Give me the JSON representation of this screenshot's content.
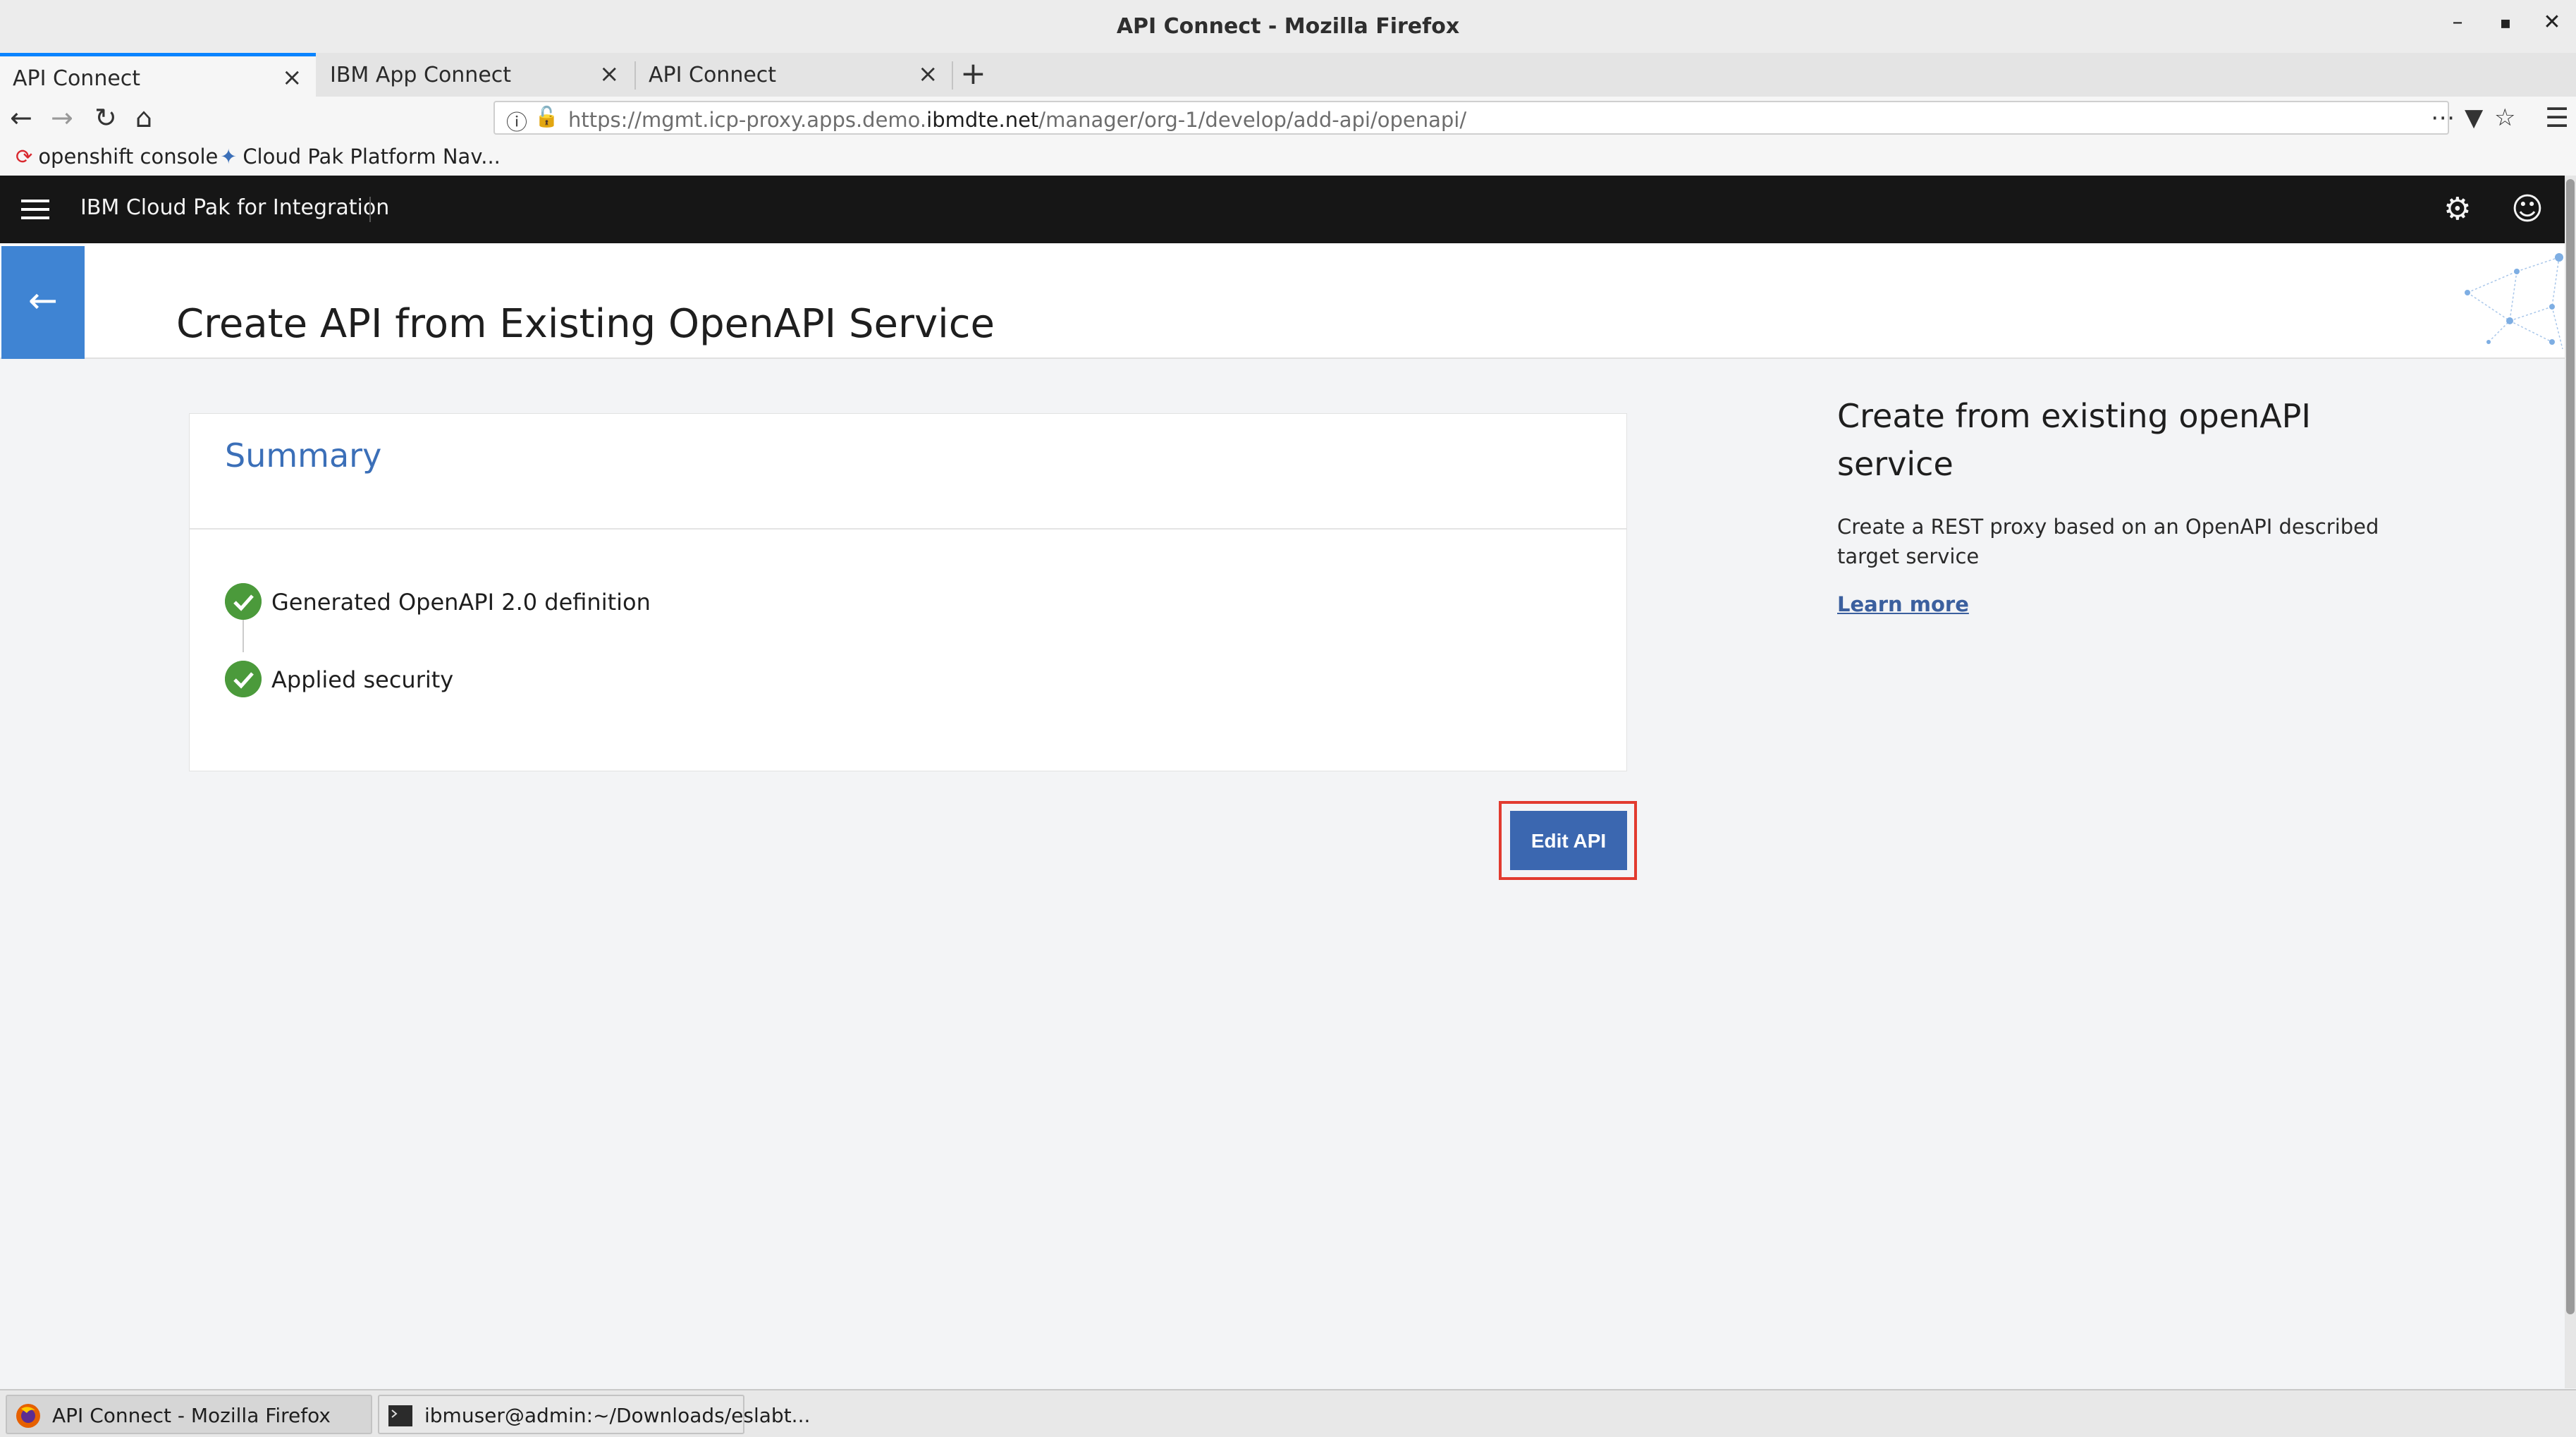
{
  "window": {
    "title": "API Connect - Mozilla Firefox"
  },
  "tabs": [
    {
      "label": "API Connect",
      "active": true
    },
    {
      "label": "IBM App Connect",
      "active": false
    },
    {
      "label": "API Connect",
      "active": false
    }
  ],
  "nav": {
    "url_prefix": "https://mgmt.icp-proxy.apps.demo.",
    "url_domain": "ibmdte.net",
    "url_suffix": "/manager/org-1/develop/add-api/openapi/"
  },
  "bookmarks": [
    {
      "label": "openshift console",
      "icon": "openshift-icon"
    },
    {
      "label": "Cloud Pak Platform Nav...",
      "icon": "cloud-pak-icon"
    }
  ],
  "app": {
    "name": "IBM Cloud Pak for Integration",
    "page_title": "Create API from Existing OpenAPI Service"
  },
  "summary": {
    "title": "Summary",
    "steps": [
      {
        "label": "Generated OpenAPI 2.0 definition",
        "status": "complete"
      },
      {
        "label": "Applied security",
        "status": "complete"
      }
    ]
  },
  "actions": {
    "edit_label": "Edit API"
  },
  "sidebar": {
    "title": "Create from existing openAPI service",
    "description": "Create a REST proxy based on an OpenAPI described target service",
    "link": "Learn more"
  },
  "taskbar": [
    {
      "label": "API Connect - Mozilla Firefox",
      "icon": "firefox-icon"
    },
    {
      "label": "ibmuser@admin:~/Downloads/eslabt...",
      "icon": "terminal-icon"
    }
  ],
  "colors": {
    "accent": "#3f84d3",
    "button": "#3b67b0",
    "success": "#4b9a3b",
    "highlight": "#e23b2f",
    "header": "#161616"
  }
}
